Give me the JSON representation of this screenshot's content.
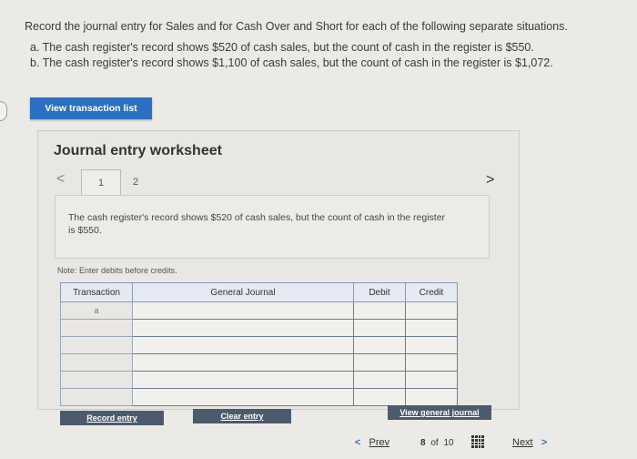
{
  "question": {
    "instruction": "Record the journal entry for Sales and for Cash Over and Short for each of the following separate situations.",
    "items": [
      "a. The cash register's record shows $520 of cash sales, but the count of cash in the register is $550.",
      "b. The cash register's record shows $1,100 of cash sales, but the count of cash in the register is $1,072."
    ]
  },
  "buttons": {
    "view_transaction_list": "View transaction list",
    "record_entry": "Record entry",
    "clear_entry": "Clear entry",
    "view_general_journal": "View general journal"
  },
  "worksheet": {
    "title": "Journal entry worksheet",
    "prev_arrow": "<",
    "next_arrow": ">",
    "tabs": [
      "1",
      "2"
    ],
    "active_tab": "1",
    "description": "The cash register's record shows $520 of cash sales, but the count of cash in the register is $550.",
    "note": "Note: Enter debits before credits."
  },
  "journal_table": {
    "headers": {
      "transaction": "Transaction",
      "general_journal": "General Journal",
      "debit": "Debit",
      "credit": "Credit"
    },
    "rows": [
      {
        "transaction": "a",
        "account": "",
        "debit": "",
        "credit": ""
      },
      {
        "transaction": "",
        "account": "",
        "debit": "",
        "credit": ""
      },
      {
        "transaction": "",
        "account": "",
        "debit": "",
        "credit": ""
      },
      {
        "transaction": "",
        "account": "",
        "debit": "",
        "credit": ""
      },
      {
        "transaction": "",
        "account": "",
        "debit": "",
        "credit": ""
      },
      {
        "transaction": "",
        "account": "",
        "debit": "",
        "credit": ""
      }
    ]
  },
  "footer": {
    "prev_label": "Prev",
    "page_current": "8",
    "page_of": "of",
    "page_total": "10",
    "next_label": "Next",
    "grid_icon": "grid-icon"
  },
  "colors": {
    "primary_button": "#2b6fc0",
    "secondary_button": "#4c5a6d"
  }
}
